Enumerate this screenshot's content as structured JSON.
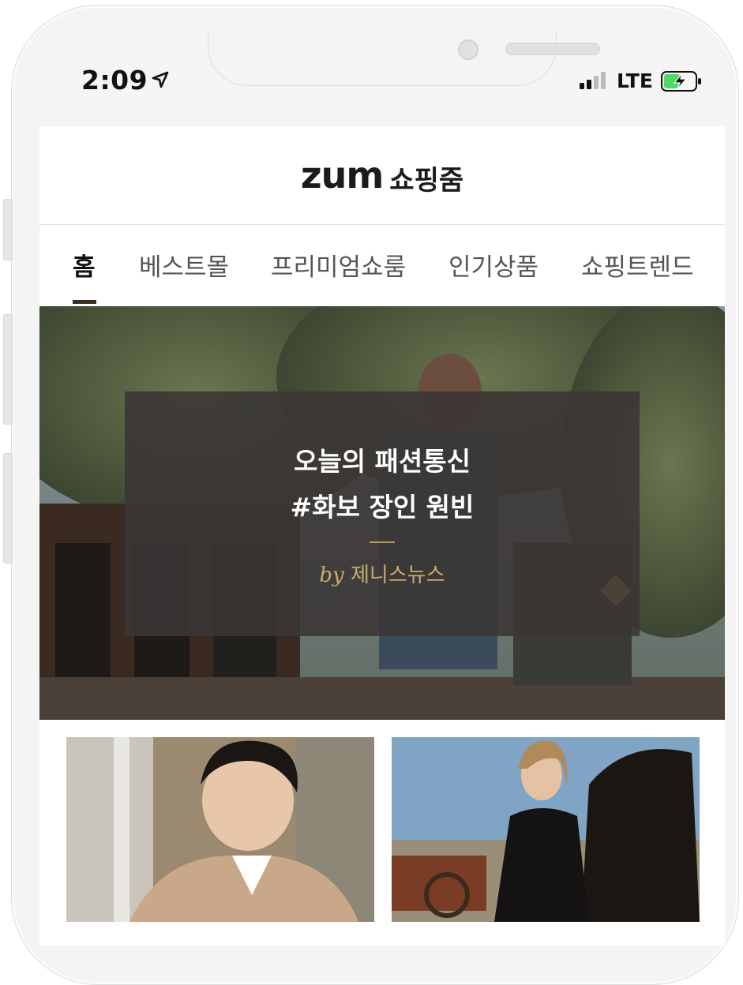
{
  "status_bar": {
    "time": "2:09",
    "network": "LTE",
    "location_icon": "location-arrow-icon",
    "signal_icon": "signal-bars-icon",
    "battery_icon": "battery-charging-icon",
    "battery_color": "#4cd964"
  },
  "header": {
    "logo_brand": "zum",
    "logo_service": "쇼핑줌"
  },
  "tabs": [
    {
      "label": "홈",
      "active": true
    },
    {
      "label": "베스트몰",
      "active": false
    },
    {
      "label": "프리미엄쇼룸",
      "active": false
    },
    {
      "label": "인기상품",
      "active": false
    },
    {
      "label": "쇼핑트렌드",
      "active": false
    }
  ],
  "hero": {
    "title_line1": "오늘의 패션통신",
    "title_line2": "#화보 장인 원빈",
    "by_prefix": "by",
    "by_source": "제니스뉴스",
    "accent_color": "#b59a52"
  },
  "cards": [
    {
      "image": "man-in-beige-coat-photo"
    },
    {
      "image": "woman-with-horse-photo"
    }
  ]
}
